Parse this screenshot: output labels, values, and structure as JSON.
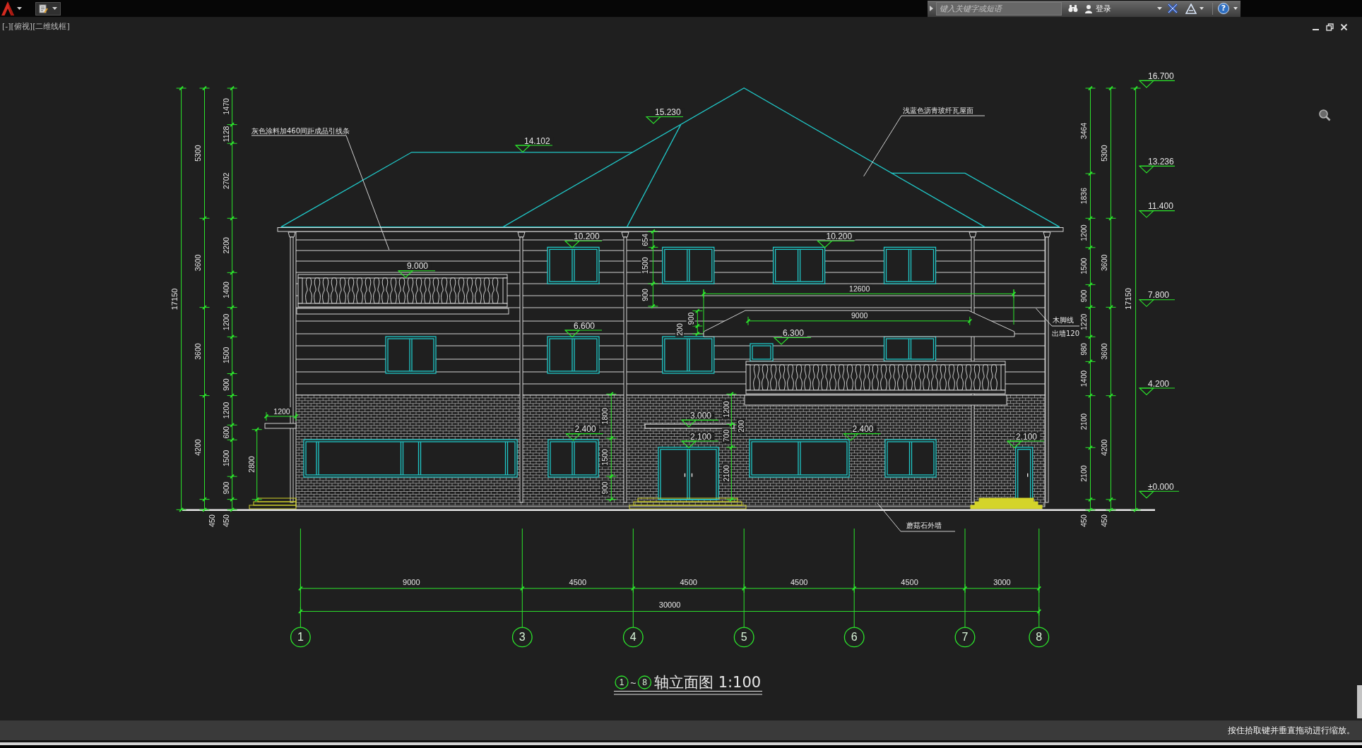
{
  "title_bar": {
    "search": {
      "placeholder": "键入关键字或短语"
    },
    "sign_in": "登录",
    "help": "?"
  },
  "viewport": {
    "label": "[-][俯视][二维线框]"
  },
  "drawing": {
    "notes": [
      "灰色涂料加460间距成品引线条",
      "浅蓝色沥青玻纤瓦屋面",
      "木脚线",
      "出墙120",
      "蘑菇石外墙"
    ],
    "levels": [
      "15.230",
      "14.102",
      "10.200",
      "10.200",
      "9.000",
      "6.600",
      "6.300",
      "3.000",
      "2.400",
      "2.100",
      "2.400",
      "2.100"
    ],
    "left_dimensions": {
      "total": "17150",
      "floors": [
        "5300",
        "3600",
        "3600",
        "4200",
        "450"
      ],
      "details": [
        "1470",
        "1128",
        "2702",
        "2200",
        "1400",
        "1200",
        "1500",
        "900",
        "1200",
        "600",
        "1500",
        "900",
        "450"
      ]
    },
    "inner_dimensions": [
      "12600",
      "9000",
      "654",
      "1500",
      "900",
      "200",
      "900",
      "1200",
      "2800",
      "1800",
      "1500",
      "900",
      "1200",
      "700",
      "2100",
      "200"
    ],
    "right_dimensions": {
      "details": [
        "3464",
        "1836",
        "1200",
        "1500",
        "900",
        "1220",
        "980",
        "1400",
        "2100",
        "2100",
        "450"
      ],
      "floors": [
        "5300",
        "3600",
        "3600",
        "4200",
        "450"
      ],
      "total": "17150",
      "levels": [
        "16.700",
        "13.236",
        "11.400",
        "7.800",
        "4.200",
        "±0.000"
      ]
    },
    "axis_dimensions": {
      "spans": [
        "9000",
        "4500",
        "4500",
        "4500",
        "4500",
        "3000"
      ],
      "total": "30000"
    },
    "axes": [
      "1",
      "3",
      "4",
      "5",
      "6",
      "7",
      "8"
    ],
    "title": {
      "from_axis": "1",
      "separator": "~",
      "to_axis": "8",
      "name": "轴立面图 1:100"
    }
  },
  "status_bar": {
    "hint": "按住拾取键并垂直拖动进行缩放。"
  }
}
